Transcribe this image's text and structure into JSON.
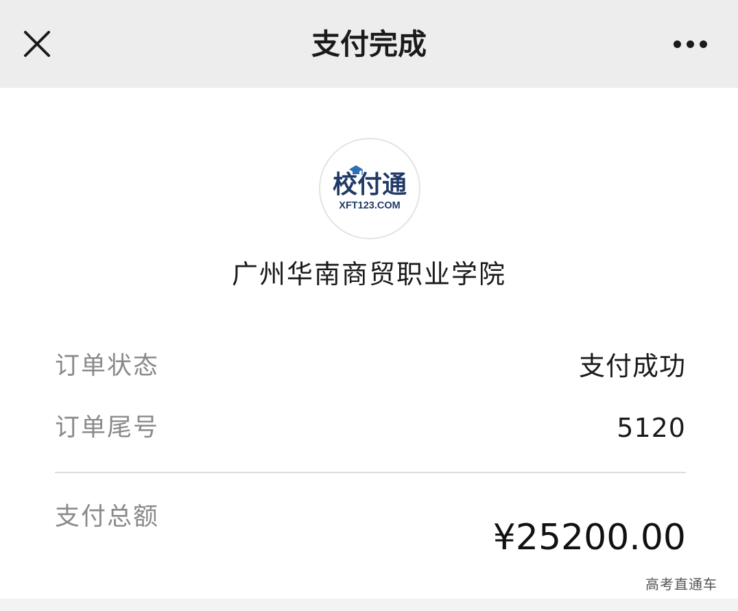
{
  "header": {
    "title": "支付完成",
    "close_icon": "close-icon",
    "more_icon": "more-dots-icon",
    "background_color": "#ededed"
  },
  "merchant": {
    "logo": {
      "text": "校付通",
      "domain_text": "XFT123.COM",
      "icon": "graduation-cap-icon"
    },
    "name": "广州华南商贸职业学院"
  },
  "order": {
    "status_label": "订单状态",
    "status_value": "支付成功",
    "tail_label": "订单尾号",
    "tail_value": "5120",
    "total_label": "支付总额",
    "total_value": "¥25200.00"
  },
  "watermark": "高考直通车"
}
